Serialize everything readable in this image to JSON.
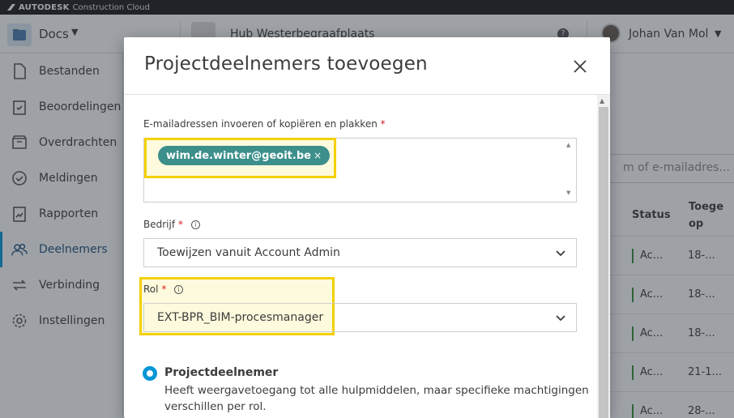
{
  "brand": {
    "logo": "AUTODESK",
    "product": "Construction Cloud"
  },
  "header": {
    "app_label": "Docs",
    "hub_name": "Hub Westerbegraafplaats",
    "help_icon": "help-icon",
    "user_name": "Johan Van Mol"
  },
  "sidebar": {
    "items": [
      {
        "label": "Bestanden",
        "icon": "file-icon"
      },
      {
        "label": "Beoordelingen",
        "icon": "review-icon"
      },
      {
        "label": "Overdrachten",
        "icon": "transmittal-icon"
      },
      {
        "label": "Meldingen",
        "icon": "issues-icon"
      },
      {
        "label": "Rapporten",
        "icon": "reports-icon"
      },
      {
        "label": "Deelnemers",
        "icon": "members-icon",
        "active": true
      },
      {
        "label": "Verbinding",
        "icon": "link-icon"
      },
      {
        "label": "Instellingen",
        "icon": "settings-icon"
      }
    ]
  },
  "background_table": {
    "search_placeholder": "m of e-mailadres...",
    "col_status": "Status",
    "col_added_line1": "Toege",
    "col_added_line2": "op",
    "rows": [
      {
        "status": "Ac...",
        "date": "18-..."
      },
      {
        "status": "Ac...",
        "date": "18-..."
      },
      {
        "status": "Ac...",
        "date": "18-..."
      },
      {
        "status": "Ac...",
        "date": "21-1..."
      },
      {
        "status": "Ac...",
        "date": "28-..."
      }
    ]
  },
  "modal": {
    "title": "Projectdeelnemers toevoegen",
    "email_label": "E-mailadressen invoeren of kopiëren en plakken",
    "email_chip": "wim.de.winter@geoit.be",
    "company_label": "Bedrijf",
    "company_value": "Toewijzen vanuit Account Admin",
    "role_label": "Rol",
    "role_value": "EXT-BPR_BIM-procesmanager",
    "required_mark": "*",
    "radio_title": "Projectdeelnemer",
    "radio_desc": "Heeft weergavetoegang tot alle hulpmiddelen, maar specifieke machtigingen verschillen per rol."
  },
  "colors": {
    "accent": "#0696d7",
    "chip": "#3c8f8b",
    "highlight": "#f5d000",
    "required": "#d71e1e"
  }
}
